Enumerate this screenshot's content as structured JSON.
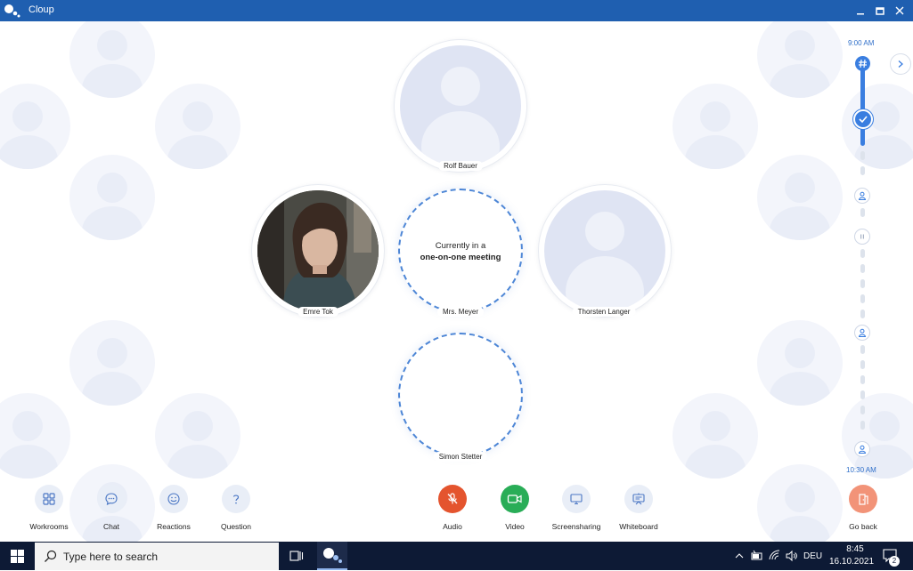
{
  "app": {
    "title": "Cloup"
  },
  "participants": {
    "top": {
      "name": "Rolf Bauer"
    },
    "left": {
      "name": "Emre Tok"
    },
    "center": {
      "name": "Mrs. Meyer",
      "status_line1": "Currently in a",
      "status_line2": "one-on-one meeting"
    },
    "right": {
      "name": "Thorsten Langer"
    },
    "bottom": {
      "name": "Simon Stetter"
    }
  },
  "timeline": {
    "start_time": "9:00 AM",
    "end_time": "10:30 AM"
  },
  "toolbar_left": [
    {
      "label": "Workrooms",
      "icon": "grid-icon"
    },
    {
      "label": "Chat",
      "icon": "chat-bubble-icon"
    },
    {
      "label": "Reactions",
      "icon": "smiley-icon"
    },
    {
      "label": "Question",
      "icon": "question-mark-icon"
    }
  ],
  "toolbar_center": [
    {
      "label": "Audio",
      "icon": "microphone-muted-icon",
      "color": "#e4542e"
    },
    {
      "label": "Video",
      "icon": "video-camera-icon",
      "color": "#29ad57"
    },
    {
      "label": "Screensharing",
      "icon": "monitor-icon"
    },
    {
      "label": "Whiteboard",
      "icon": "whiteboard-icon"
    }
  ],
  "go_back": {
    "label": "Go back",
    "icon": "exit-door-icon",
    "color": "#f29378"
  },
  "taskbar": {
    "search_placeholder": "Type here to search",
    "language": "DEU",
    "time": "8:45",
    "date": "16.10.2021",
    "notification_count": "2"
  },
  "colors": {
    "accent": "#2f6fc9",
    "titlebar": "#1f5fb0",
    "taskbar": "#0d1a35"
  }
}
